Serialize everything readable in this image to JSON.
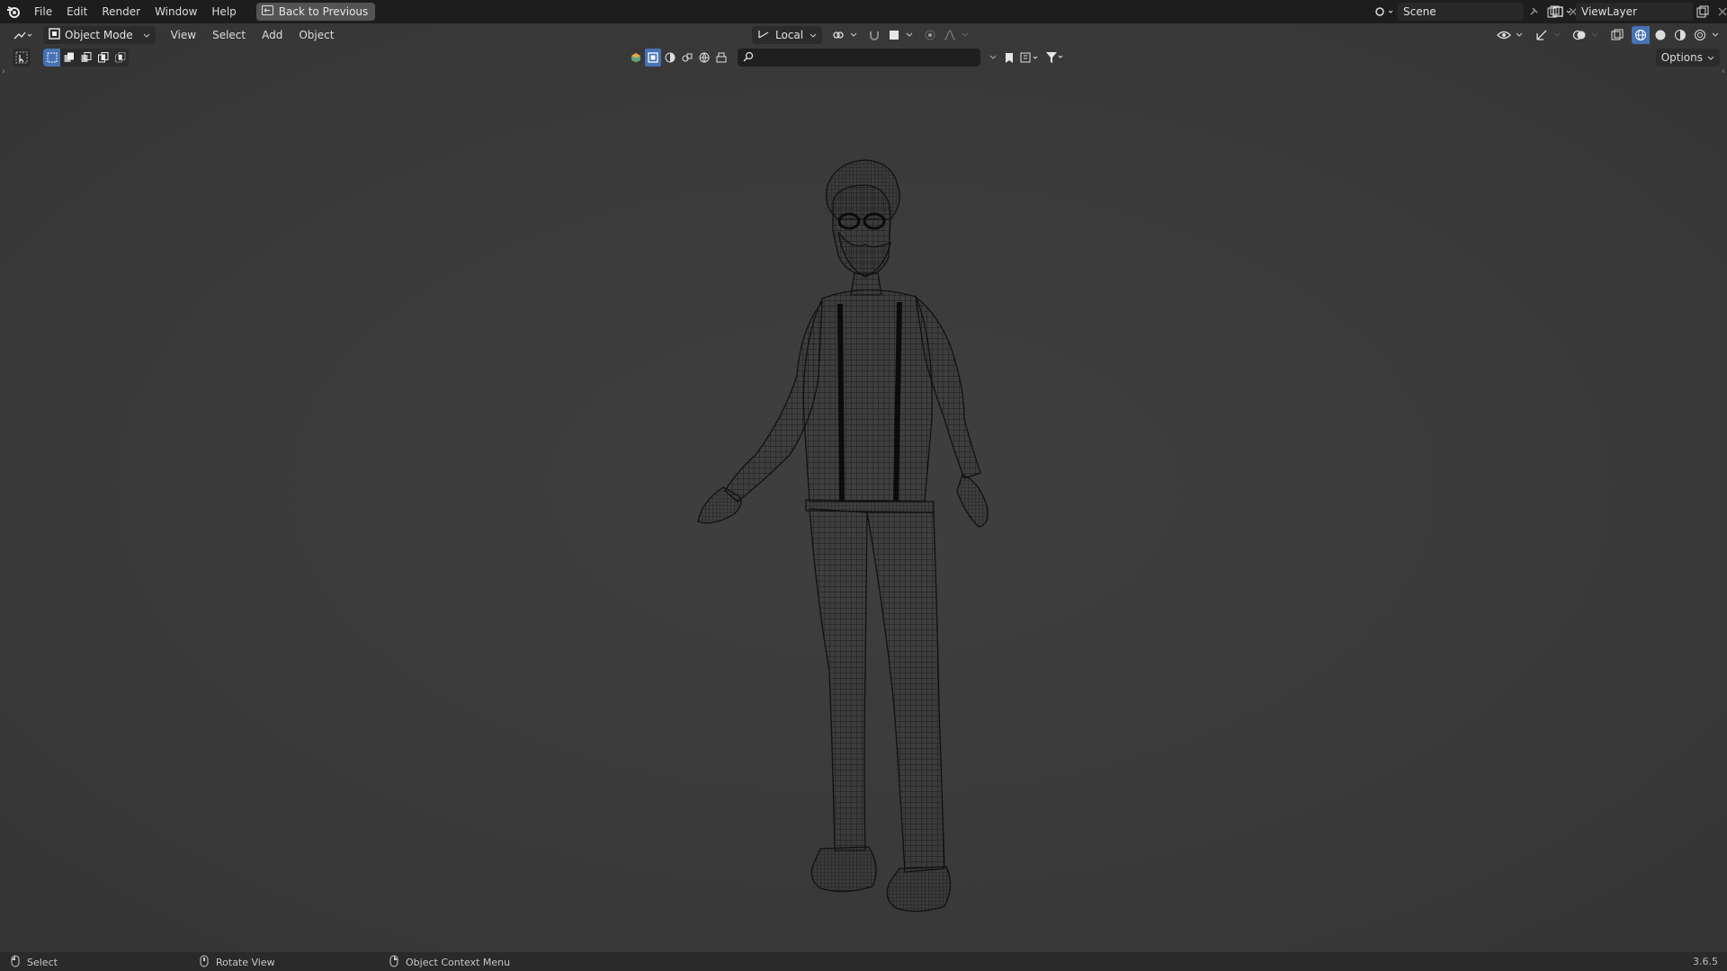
{
  "topbar": {
    "menus": [
      "File",
      "Edit",
      "Render",
      "Window",
      "Help"
    ],
    "back_button": "Back to Previous",
    "scene_name": "Scene",
    "view_layer_name": "ViewLayer"
  },
  "viewport_header": {
    "mode": "Object Mode",
    "menus": [
      "View",
      "Select",
      "Add",
      "Object"
    ],
    "orientation": "Local",
    "options_label": "Options",
    "search_placeholder": ""
  },
  "statusbar": {
    "items": [
      "Select",
      "Rotate View",
      "Object Context Menu"
    ],
    "version": "3.6.5"
  },
  "icons": {
    "logo": "blender-logo-icon",
    "back": "screen-back-icon",
    "shading_modes": [
      "wireframe-shading-icon",
      "solid-shading-icon",
      "material-preview-icon",
      "rendered-shading-icon"
    ]
  },
  "colors": {
    "accent": "#4772b3",
    "viewport_bg": "#3a3a3a",
    "header_bg": "#1d1d1d",
    "wire": "#0f0f0f"
  }
}
